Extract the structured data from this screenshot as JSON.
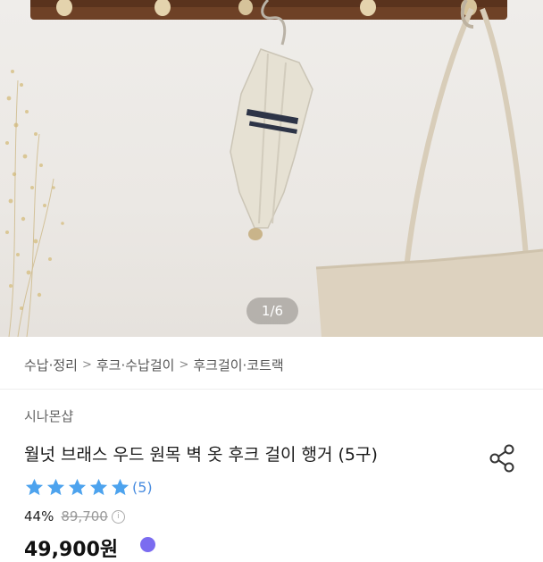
{
  "product_image": {
    "counter": "1/6",
    "alt_subject": "wall hook hanger with umbrella and tote bag"
  },
  "breadcrumb": [
    {
      "label": "수납·정리"
    },
    {
      "label": "후크·수납걸이"
    },
    {
      "label": "후크걸이·코트랙"
    }
  ],
  "product": {
    "seller": "시나몬샵",
    "title": "월넛 브래스 우드 원목 벽 옷 후크 걸이 행거 (5구)",
    "rating": 5,
    "rating_max": 5,
    "review_count": "(5)",
    "discount": "44%",
    "original_price": "89,700",
    "final_price": "49,900원"
  },
  "colors": {
    "star": "#4da3ee",
    "review_link": "#4a8de0",
    "wood": "#7a4a2c",
    "brass": "#d8c39a"
  },
  "icons": {
    "share": "share-icon",
    "info": "info-icon",
    "separator": "chevron-right-icon"
  }
}
